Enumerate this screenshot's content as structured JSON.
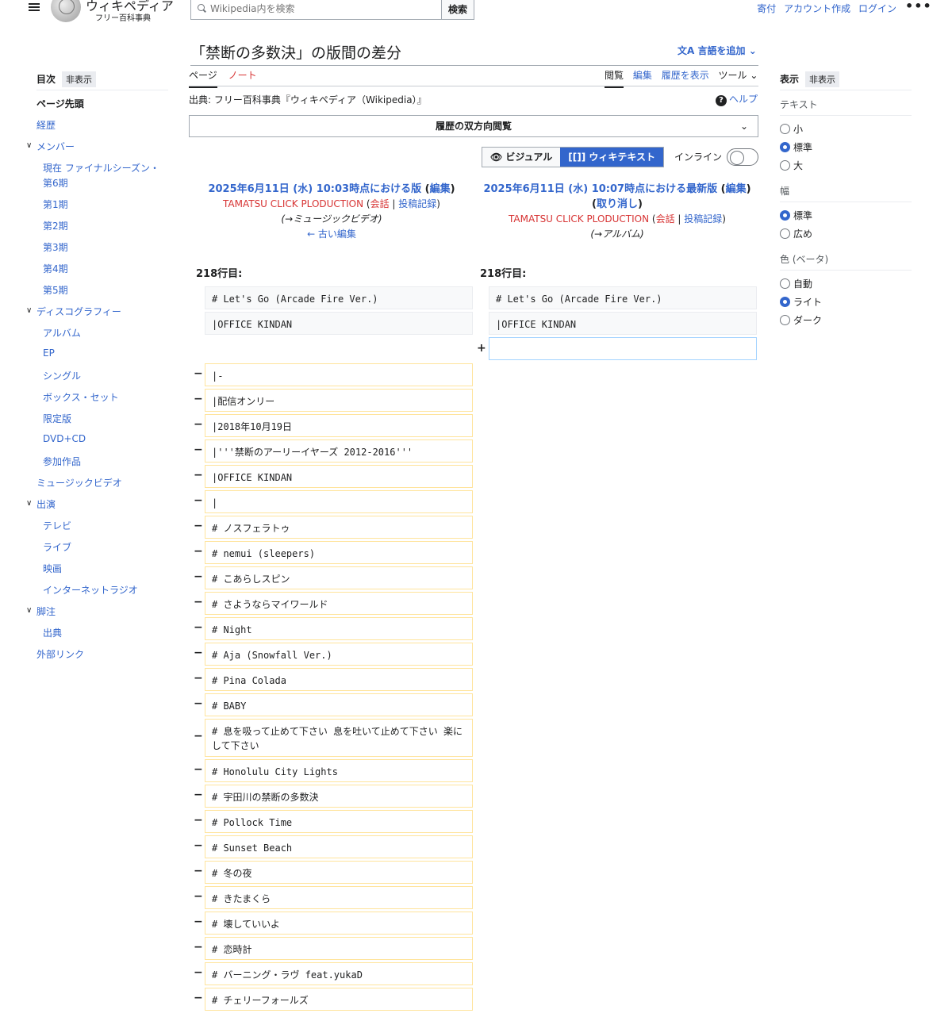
{
  "header": {
    "logo_title": "ウィキペディア",
    "logo_subtitle": "フリー百科事典",
    "search_placeholder": "Wikipedia内を検索",
    "search_button": "検索",
    "links": [
      "寄付",
      "アカウント作成",
      "ログイン"
    ],
    "more": "•••"
  },
  "page": {
    "title": "「禁断の多数決」の版間の差分",
    "add_languages": "言語を追加",
    "tabs_left": [
      "ページ",
      "ノート"
    ],
    "tabs_right": [
      "閲覧",
      "編集",
      "履歴を表示",
      "ツール"
    ],
    "source": "出典: フリー百科事典『ウィキペディア（Wikipedia）』",
    "help": "ヘルプ",
    "history_bar": "履歴の双方向閲覧",
    "visual": "ビジュアル",
    "wikitext": "ウィキテキスト",
    "inline": "インライン"
  },
  "revisions": {
    "left": {
      "heading": "2025年6月11日 (水) 10:03時点における版",
      "edit": "編集",
      "user": "TAMATSU CLICK PLODUCTION",
      "talk": "会話",
      "contribs": "投稿記録",
      "summary": "(→ミュージックビデオ)",
      "older": "← 古い編集"
    },
    "right": {
      "heading": "2025年6月11日 (水) 10:07時点における最新版",
      "edit": "編集",
      "undo": "取り消し",
      "user": "TAMATSU CLICK PLODUCTION",
      "talk": "会話",
      "contribs": "投稿記録",
      "summary": "(→アルバム)"
    }
  },
  "diff": {
    "left_lineno": "218行目:",
    "right_lineno": "218行目:",
    "context": [
      "# Let's Go (Arcade Fire Ver.)",
      "|OFFICE KINDAN"
    ],
    "added": [
      ""
    ],
    "removed": [
      "|-",
      "|配信オンリー",
      "|2018年10月19日",
      "|'''禁断のアーリーイヤーズ 2012-2016'''",
      "|OFFICE KINDAN",
      "|",
      "# ノスフェラトゥ",
      "# nemui (sleepers)",
      "# こあらしスピン",
      "# さようならマイワールド",
      "# Night",
      "# Aja (Snowfall Ver.)",
      "# Pina Colada",
      "# BABY",
      "# 息を吸って止めて下さい 息を吐いて止めて下さい 楽にして下さい",
      "# Honolulu City Lights",
      "# 宇田川の禁断の多数決",
      "# Pollock Time",
      "# Sunset Beach",
      "# 冬の夜",
      "# きたまくら",
      "# 壊していいよ",
      "# 恋時計",
      "# バーニング・ラヴ feat.yukaD",
      "# チェリーフォールズ"
    ]
  },
  "toc": {
    "title": "目次",
    "hide": "非表示",
    "items": [
      {
        "label": "ページ先頭",
        "level": 0,
        "top": true
      },
      {
        "label": "経歴",
        "level": 0
      },
      {
        "label": "メンバー",
        "level": 0,
        "expand": true
      },
      {
        "label": "現在 ファイナルシーズン・第6期",
        "level": 1
      },
      {
        "label": "第1期",
        "level": 1
      },
      {
        "label": "第2期",
        "level": 1
      },
      {
        "label": "第3期",
        "level": 1
      },
      {
        "label": "第4期",
        "level": 1
      },
      {
        "label": "第5期",
        "level": 1
      },
      {
        "label": "ディスコグラフィー",
        "level": 0,
        "expand": true
      },
      {
        "label": "アルバム",
        "level": 1
      },
      {
        "label": "EP",
        "level": 1
      },
      {
        "label": "シングル",
        "level": 1
      },
      {
        "label": "ボックス・セット",
        "level": 1
      },
      {
        "label": "限定版",
        "level": 1
      },
      {
        "label": "DVD+CD",
        "level": 1
      },
      {
        "label": "参加作品",
        "level": 1
      },
      {
        "label": "ミュージックビデオ",
        "level": 0
      },
      {
        "label": "出演",
        "level": 0,
        "expand": true
      },
      {
        "label": "テレビ",
        "level": 1
      },
      {
        "label": "ライブ",
        "level": 1
      },
      {
        "label": "映画",
        "level": 1
      },
      {
        "label": "インターネットラジオ",
        "level": 1
      },
      {
        "label": "脚注",
        "level": 0,
        "expand": true
      },
      {
        "label": "出典",
        "level": 1
      },
      {
        "label": "外部リンク",
        "level": 0
      }
    ]
  },
  "appearance": {
    "title": "表示",
    "hide": "非表示",
    "sections": [
      {
        "label": "テキスト",
        "options": [
          "小",
          "標準",
          "大"
        ],
        "selected": 1
      },
      {
        "label": "幅",
        "options": [
          "標準",
          "広め"
        ],
        "selected": 0
      },
      {
        "label": "色 (ベータ)",
        "options": [
          "自動",
          "ライト",
          "ダーク"
        ],
        "selected": 1
      }
    ]
  },
  "colors": {
    "link": "#3366cc",
    "red_link": "#d73333",
    "removed_border": "#ffe49c",
    "added_border": "#a3d3ff",
    "accent": "#3366cc"
  }
}
